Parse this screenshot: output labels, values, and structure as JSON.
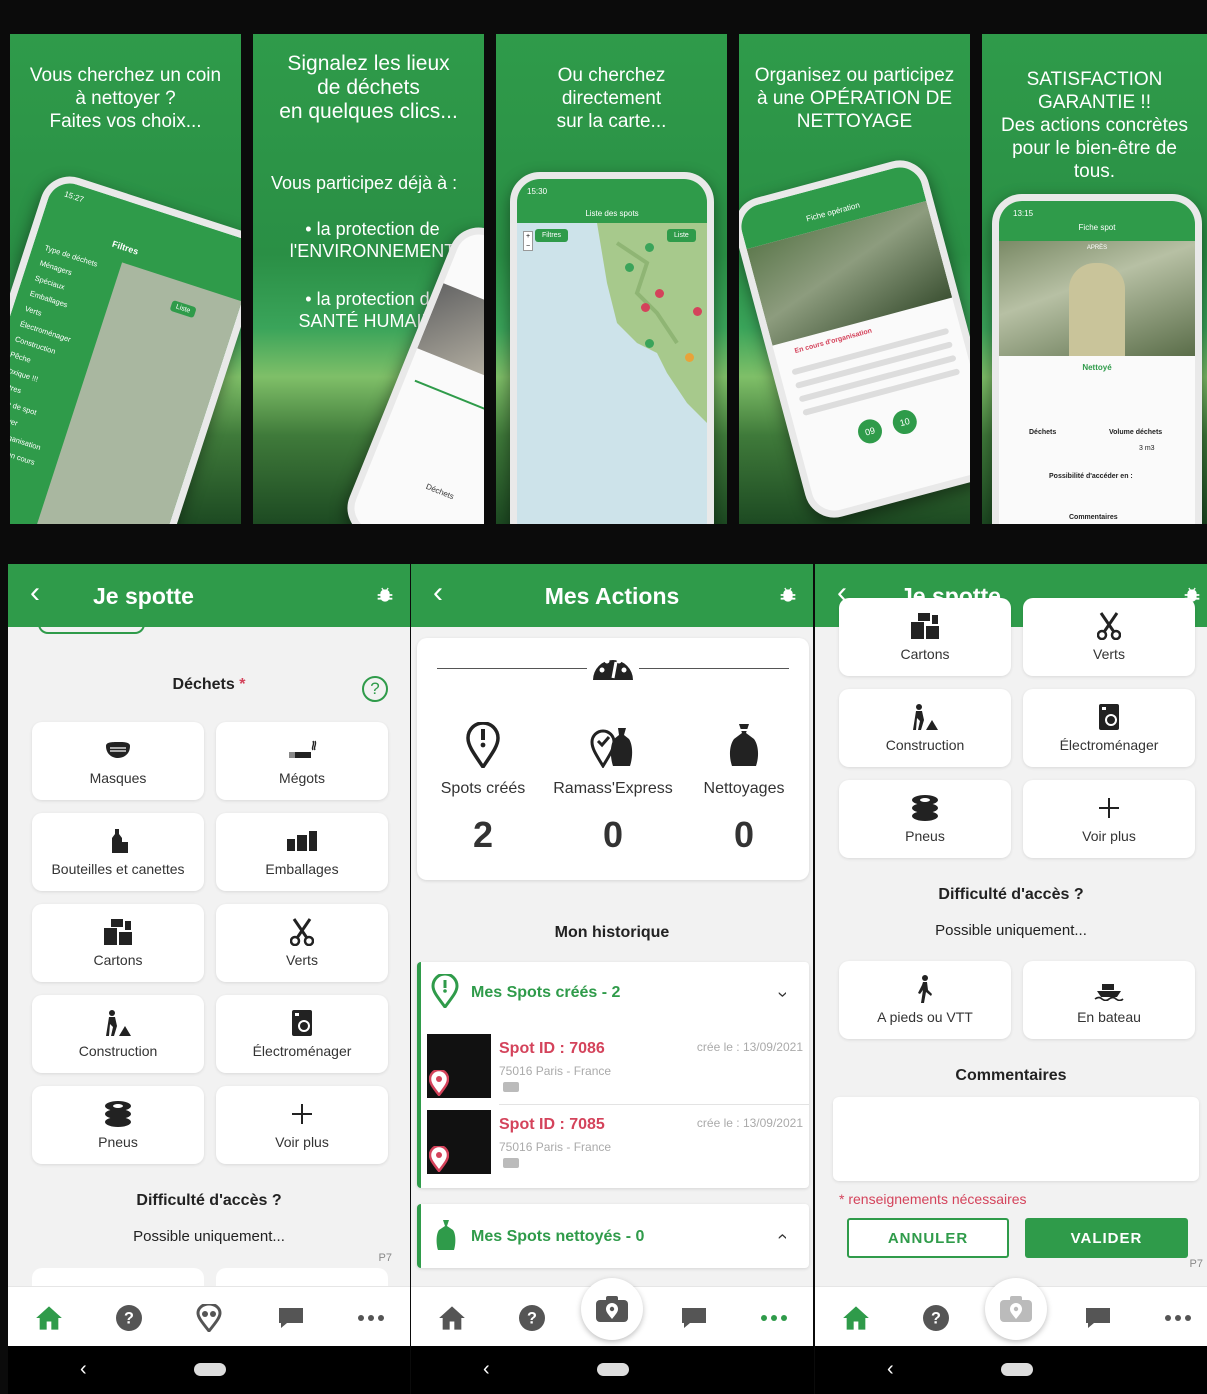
{
  "promo": [
    {
      "caption": "Vous cherchez un coin\nà nettoyer ?\nFaites vos choix...",
      "phone_time": "15:27",
      "phone_title": "Filtres",
      "phone_items": [
        "Type de déchets",
        "Ménagers",
        "Spéciaux",
        "Emballages",
        "Verts",
        "Électroménager",
        "Construction",
        "Pêche",
        "Toxique !!!",
        "Autres",
        "Type de spot",
        "Nettoyer",
        "En d'organisation",
        "Nettoyé en cours"
      ],
      "phone_button": "Liste"
    },
    {
      "caption": "Signalez les lieux\nde déchets\nen quelques clics...",
      "sub1": "Vous participez déjà à :",
      "bullet1": "• la protection de\nl'ENVIRONNEMENT",
      "bullet2": "• la protection de\nSANTÉ HUMAINE",
      "phone_label": "Déchets"
    },
    {
      "caption": "Ou cherchez\ndirectement\nsur la carte...",
      "phone_time": "15:30",
      "phone_title": "Liste des spots",
      "btn_filter": "Filtres",
      "btn_list": "Liste"
    },
    {
      "caption": "Organisez ou participez\nà une OPÉRATION DE\nNETTOYAGE",
      "phone_title": "Fiche opération",
      "phone_label": "En cours d'organisation",
      "date1": "09",
      "date2": "10"
    },
    {
      "caption": "SATISFACTION\nGARANTIE !!\nDes actions concrètes\npour le bien-être de\ntous.",
      "phone_time": "13:15",
      "phone_title": "Fiche spot",
      "phone_sub": "APRÈS",
      "status": "Nettoyé",
      "label_dechets": "Déchets",
      "label_volume": "Volume déchets",
      "volume": "3 m3",
      "label_access": "Possibilité d'accéder en :",
      "label_comments": "Commentaires"
    }
  ],
  "screen1": {
    "title": "Je spotte",
    "dechets_label": "Déchets",
    "required_mark": "*",
    "tiles": [
      {
        "label": "Masques",
        "icon": "mask-icon"
      },
      {
        "label": "Mégots",
        "icon": "cigarette-icon"
      },
      {
        "label": "Bouteilles et canettes",
        "icon": "bottle-icon"
      },
      {
        "label": "Emballages",
        "icon": "packaging-icon"
      },
      {
        "label": "Cartons",
        "icon": "boxes-icon"
      },
      {
        "label": "Verts",
        "icon": "scissors-icon"
      },
      {
        "label": "Construction",
        "icon": "worker-icon"
      },
      {
        "label": "Électroménager",
        "icon": "appliance-icon"
      },
      {
        "label": "Pneus",
        "icon": "tires-icon"
      },
      {
        "label": "Voir plus",
        "icon": "plus-icon"
      }
    ],
    "access_title": "Difficulté d'accès ?",
    "access_sub": "Possible uniquement...",
    "page_tag": "P7"
  },
  "screen2": {
    "title": "Mes Actions",
    "stats": [
      {
        "label": "Spots créés",
        "value": "2",
        "icon": "pin-alert-icon"
      },
      {
        "label": "Ramass'Express",
        "value": "0",
        "icon": "pin-bag-icon"
      },
      {
        "label": "Nettoyages",
        "value": "0",
        "icon": "trash-bag-icon"
      }
    ],
    "history_title": "Mon historique",
    "created_header": "Mes Spots créés - 2",
    "spots": [
      {
        "id": "Spot ID : 7086",
        "location": "75016 Paris - France",
        "date": "crée le : 13/09/2021"
      },
      {
        "id": "Spot ID : 7085",
        "location": "75016 Paris - France",
        "date": "crée le : 13/09/2021"
      }
    ],
    "cleaned_header": "Mes Spots nettoyés - 0"
  },
  "screen3": {
    "title": "Je spotte",
    "tiles": [
      {
        "label": "Cartons",
        "icon": "boxes-icon"
      },
      {
        "label": "Verts",
        "icon": "scissors-icon"
      },
      {
        "label": "Construction",
        "icon": "worker-icon"
      },
      {
        "label": "Électroménager",
        "icon": "appliance-icon"
      },
      {
        "label": "Pneus",
        "icon": "tires-icon"
      },
      {
        "label": "Voir plus",
        "icon": "plus-icon"
      }
    ],
    "access_title": "Difficulté d'accès ?",
    "access_sub": "Possible uniquement...",
    "access_tiles": [
      {
        "label": "A pieds ou VTT",
        "icon": "walker-icon"
      },
      {
        "label": "En bateau",
        "icon": "boat-icon"
      }
    ],
    "comments_title": "Commentaires",
    "required_note": "* renseignements nécessaires",
    "cancel": "ANNULER",
    "validate": "VALIDER",
    "page_tag": "P7"
  },
  "colors": {
    "green": "#2f9b4a",
    "red": "#d4435b",
    "background": "#f2f2f2"
  }
}
